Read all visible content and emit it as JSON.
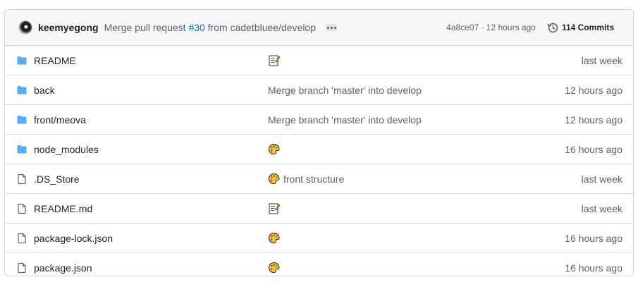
{
  "header": {
    "author": "keemyegong",
    "message_prefix": "Merge pull request ",
    "pr_link": "#30",
    "message_suffix": " from cadetbluee/develop",
    "sha_time": "4a8ce07 · 12 hours ago",
    "commits_label": "114 Commits",
    "history_icon": "history-icon",
    "more_icon": "ellipsis-icon"
  },
  "files": [
    {
      "type": "folder",
      "name": "README",
      "emoji": "memo",
      "message": "",
      "age": "last week"
    },
    {
      "type": "folder",
      "name": "back",
      "emoji": "",
      "message": "Merge branch 'master' into develop",
      "age": "12 hours ago"
    },
    {
      "type": "folder",
      "name": "front/meova",
      "emoji": "",
      "message": "Merge branch 'master' into develop",
      "age": "12 hours ago"
    },
    {
      "type": "folder",
      "name": "node_modules",
      "emoji": "art",
      "message": "",
      "age": "16 hours ago"
    },
    {
      "type": "file",
      "name": ".DS_Store",
      "emoji": "art",
      "message": "front structure",
      "age": "last week"
    },
    {
      "type": "file",
      "name": "README.md",
      "emoji": "memo",
      "message": "",
      "age": "last week"
    },
    {
      "type": "file",
      "name": "package-lock.json",
      "emoji": "art",
      "message": "",
      "age": "16 hours ago"
    },
    {
      "type": "file",
      "name": "package.json",
      "emoji": "art",
      "message": "",
      "age": "16 hours ago"
    }
  ],
  "colors": {
    "folder": "#54aeff",
    "link": "#0969da",
    "muted": "#59636e",
    "border": "#d0d7de",
    "header_bg": "#f6f8fa"
  }
}
